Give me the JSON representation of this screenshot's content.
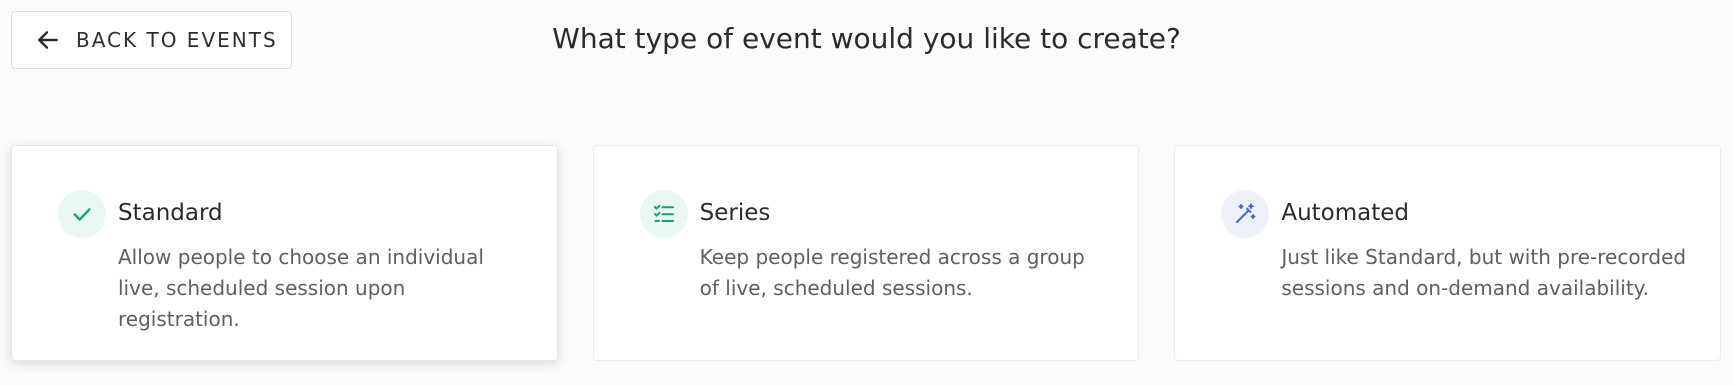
{
  "header": {
    "back_label": "BACK TO EVENTS",
    "title": "What type of event would you like to create?"
  },
  "cards": [
    {
      "title": "Standard",
      "description": "Allow people to choose an individual live, scheduled session upon registration.",
      "icon": "check-icon",
      "icon_bg": "#e9f8f2",
      "icon_color": "#1aa46b",
      "selected": true
    },
    {
      "title": "Series",
      "description": "Keep people registered across a group of live, scheduled sessions.",
      "icon": "list-check-icon",
      "icon_bg": "#e9f8f2",
      "icon_color": "#1aa46b",
      "selected": false
    },
    {
      "title": "Automated",
      "description": "Just like Standard, but with pre-recorded sessions and on-demand availability.",
      "icon": "magic-wand-icon",
      "icon_bg": "#eef1f9",
      "icon_color": "#4a69c6",
      "selected": false
    }
  ],
  "colors": {
    "background": "#fbfbfb",
    "card_background": "#ffffff",
    "text_primary": "#2a2a2a",
    "text_secondary": "#5f5f5f"
  }
}
